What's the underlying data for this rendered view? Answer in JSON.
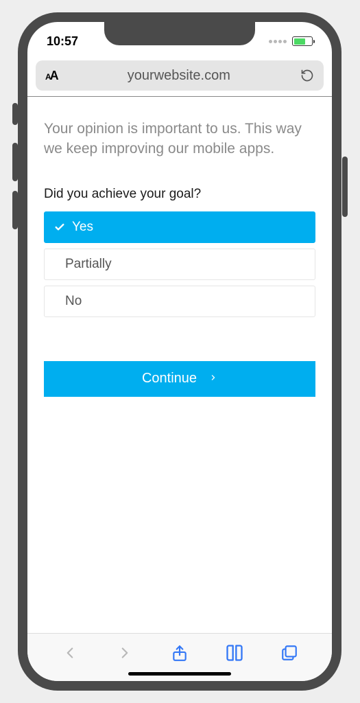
{
  "status": {
    "time": "10:57"
  },
  "browser": {
    "url": "yourwebsite.com"
  },
  "survey": {
    "intro": "Your opinion is important to us. This way we keep improving our mobile apps.",
    "question": "Did you achieve your goal?",
    "options": {
      "yes": "Yes",
      "partially": "Partially",
      "no": "No"
    },
    "continue_label": "Continue"
  }
}
